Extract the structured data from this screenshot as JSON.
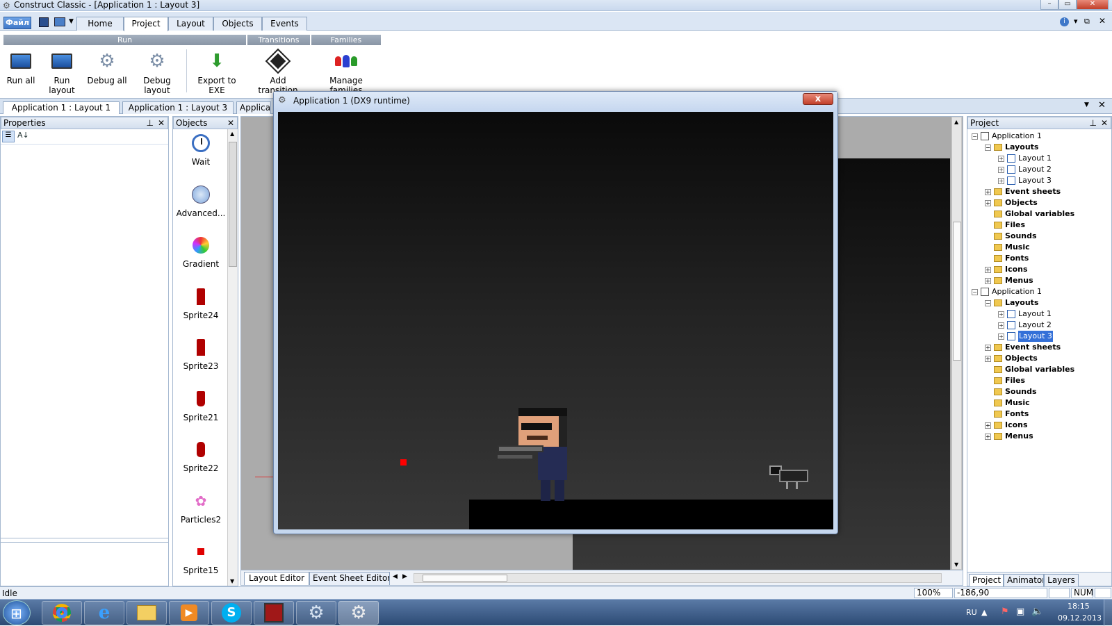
{
  "window": {
    "title": "Construct Classic - [Application 1 : Layout 3]"
  },
  "ribbon": {
    "file_label": "Файл",
    "tabs": [
      {
        "label": "Home"
      },
      {
        "label": "Project"
      },
      {
        "label": "Layout"
      },
      {
        "label": "Objects"
      },
      {
        "label": "Events"
      }
    ],
    "groups": {
      "run": "Run",
      "transitions": "Transitions",
      "families": "Families"
    },
    "buttons": {
      "run_all": "Run all",
      "run_layout": "Run layout",
      "debug_all": "Debug all",
      "debug_layout": "Debug layout",
      "export_exe": "Export to EXE",
      "add_transition": "Add transition",
      "manage_families": "Manage families"
    }
  },
  "doc_tabs": [
    "Application 1 : Layout 1",
    "Application 1 : Layout 3",
    "Applica"
  ],
  "properties": {
    "title": "Properties"
  },
  "objects": {
    "title": "Objects",
    "items": [
      {
        "label": "Wait",
        "icon": "clock-icon"
      },
      {
        "label": "Advanced...",
        "icon": "camera-icon"
      },
      {
        "label": "Gradient",
        "icon": "gradient-icon"
      },
      {
        "label": "Sprite24",
        "icon": "sprite-icon"
      },
      {
        "label": "Sprite23",
        "icon": "sprite-icon"
      },
      {
        "label": "Sprite21",
        "icon": "sprite-icon"
      },
      {
        "label": "Sprite22",
        "icon": "sprite-icon"
      },
      {
        "label": "Particles2",
        "icon": "particles-icon"
      },
      {
        "label": "Sprite15",
        "icon": "sprite-icon"
      }
    ]
  },
  "editor": {
    "tabs": [
      "Layout Editor",
      "Event Sheet Editor"
    ]
  },
  "runtime": {
    "title": "Application 1 (DX9 runtime)",
    "close": "x"
  },
  "project": {
    "title": "Project",
    "tree": [
      {
        "label": "Application 1"
      },
      {
        "label": "Layouts"
      },
      {
        "label": "Layout 1"
      },
      {
        "label": "Layout 2"
      },
      {
        "label": "Layout 3"
      },
      {
        "label": "Event sheets"
      },
      {
        "label": "Objects"
      },
      {
        "label": "Global variables"
      },
      {
        "label": "Files"
      },
      {
        "label": "Sounds"
      },
      {
        "label": "Music"
      },
      {
        "label": "Fonts"
      },
      {
        "label": "Icons"
      },
      {
        "label": "Menus"
      },
      {
        "label": "Application 1"
      },
      {
        "label": "Layouts"
      },
      {
        "label": "Layout 1"
      },
      {
        "label": "Layout 2"
      },
      {
        "label": "Layout 3"
      },
      {
        "label": "Event sheets"
      },
      {
        "label": "Objects"
      },
      {
        "label": "Global variables"
      },
      {
        "label": "Files"
      },
      {
        "label": "Sounds"
      },
      {
        "label": "Music"
      },
      {
        "label": "Fonts"
      },
      {
        "label": "Icons"
      },
      {
        "label": "Menus"
      }
    ],
    "bottom_tabs": [
      "Project",
      "Animator",
      "Layers"
    ]
  },
  "status": {
    "text": "Idle",
    "zoom": "100%",
    "coords": "-186,90",
    "num": "NUM"
  },
  "taskbar": {
    "lang": "RU",
    "time": "18:15",
    "date": "09.12.2013"
  },
  "colors": {
    "accent": "#3f78c9",
    "selected": "#3470d8",
    "red_marker": "#ff0000",
    "sprite_red": "#b00000"
  }
}
